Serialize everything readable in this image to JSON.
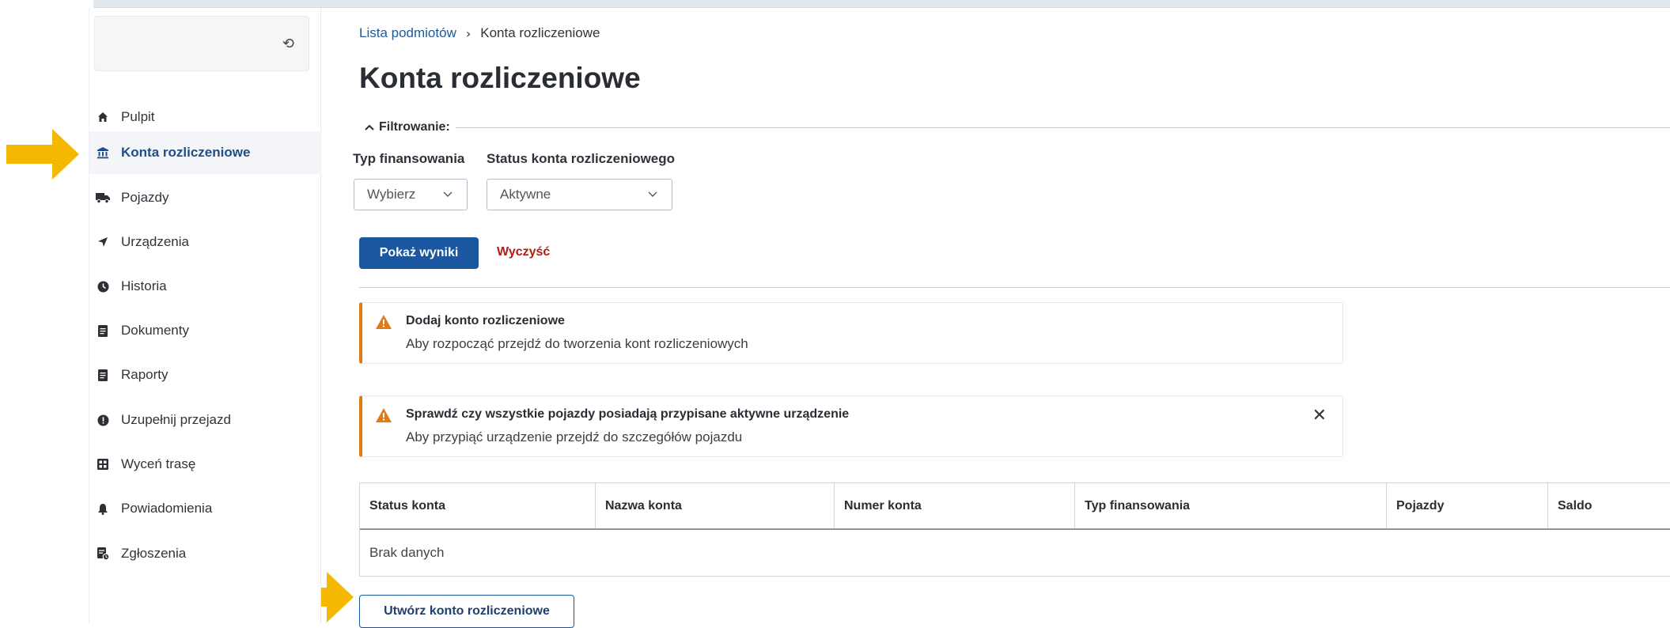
{
  "sidebar": {
    "collapse_glyph": "⟲",
    "items": [
      {
        "label": "Pulpit",
        "icon": "home-icon"
      },
      {
        "label": "Konta rozliczeniowe",
        "icon": "bank-icon",
        "active": true
      },
      {
        "label": "Pojazdy",
        "icon": "truck-icon"
      },
      {
        "label": "Urządzenia",
        "icon": "navigation-arrow-icon"
      },
      {
        "label": "Historia",
        "icon": "clock-icon"
      },
      {
        "label": "Dokumenty",
        "icon": "document-icon"
      },
      {
        "label": "Raporty",
        "icon": "report-icon"
      },
      {
        "label": "Uzupełnij przejazd",
        "icon": "alert-circle-icon"
      },
      {
        "label": "Wyceń trasę",
        "icon": "calculator-icon"
      },
      {
        "label": "Powiadomienia",
        "icon": "bell-icon"
      },
      {
        "label": "Zgłoszenia",
        "icon": "ticket-icon"
      }
    ]
  },
  "breadcrumb": {
    "link": "Lista podmiotów",
    "separator": "›",
    "current": "Konta rozliczeniowe"
  },
  "page_title": "Konta rozliczeniowe",
  "filter": {
    "heading": "Filtrowanie:",
    "type_label": "Typ finansowania",
    "type_value": "Wybierz",
    "status_label": "Status konta rozliczeniowego",
    "status_value": "Aktywne",
    "show_button": "Pokaż wyniki",
    "clear_button": "Wyczyść"
  },
  "alerts": [
    {
      "title": "Dodaj konto rozliczeniowe",
      "text": "Aby rozpocząć przejdź do tworzenia kont rozliczeniowych",
      "closable": false
    },
    {
      "title": "Sprawdź czy wszystkie pojazdy posiadają przypisane aktywne urządzenie",
      "text": "Aby przypiąć urządzenie przejdź do szczegółów pojazdu",
      "closable": true,
      "close_glyph": "✕"
    }
  ],
  "table": {
    "columns": [
      "Status konta",
      "Nazwa konta",
      "Numer konta",
      "Typ finansowania",
      "Pojazdy",
      "Saldo"
    ],
    "empty_text": "Brak danych"
  },
  "create_button": "Utwórz konto rozliczeniowe",
  "colors": {
    "accent": "#1b57a0",
    "danger": "#b01b16",
    "warning": "#e07c16",
    "annotation_arrow": "#f5b800"
  }
}
